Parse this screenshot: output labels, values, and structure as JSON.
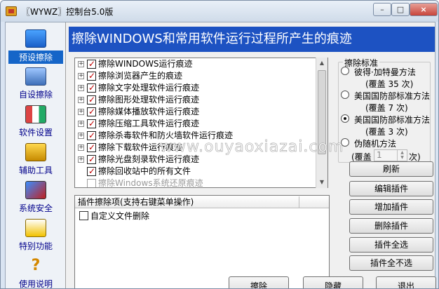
{
  "window": {
    "title": "〖WYWZ〗控制台5.0版",
    "min_label": "–",
    "max_label": "□",
    "close_label": "×"
  },
  "sidebar": {
    "items": [
      {
        "label": "预设擦除",
        "icon": "preset-erase-icon",
        "selected": true
      },
      {
        "label": "自设擦除",
        "icon": "custom-erase-icon",
        "selected": false
      },
      {
        "label": "软件设置",
        "icon": "software-settings-icon",
        "selected": false
      },
      {
        "label": "辅助工具",
        "icon": "helper-tools-icon",
        "selected": false
      },
      {
        "label": "系统安全",
        "icon": "system-security-icon",
        "selected": false
      },
      {
        "label": "特别功能",
        "icon": "special-features-icon",
        "selected": false
      },
      {
        "label": "使用说明",
        "icon": "help-icon",
        "selected": false
      }
    ]
  },
  "banner": "擦除WINDOWS和常用软件运行过程所产生的痕迹",
  "tree": {
    "items": [
      {
        "label": "擦除WINDOWS运行痕迹",
        "checked": true,
        "expandable": true,
        "disabled": false
      },
      {
        "label": "擦除浏览器产生的痕迹",
        "checked": true,
        "expandable": true,
        "disabled": false
      },
      {
        "label": "擦除文字处理软件运行痕迹",
        "checked": true,
        "expandable": true,
        "disabled": false
      },
      {
        "label": "擦除图形处理软件运行痕迹",
        "checked": true,
        "expandable": true,
        "disabled": false
      },
      {
        "label": "擦除媒体播放软件运行痕迹",
        "checked": true,
        "expandable": true,
        "disabled": false
      },
      {
        "label": "擦除压缩工具软件运行痕迹",
        "checked": true,
        "expandable": true,
        "disabled": false
      },
      {
        "label": "擦除杀毒软件和防火墙软件运行痕迹",
        "checked": true,
        "expandable": true,
        "disabled": false
      },
      {
        "label": "擦除下载软件运行痕迹",
        "checked": true,
        "expandable": true,
        "disabled": false
      },
      {
        "label": "擦除光盘刻录软件运行痕迹",
        "checked": true,
        "expandable": true,
        "disabled": false
      },
      {
        "label": "擦除回收站中的所有文件",
        "checked": true,
        "expandable": false,
        "disabled": false
      },
      {
        "label": "擦除Windows系统还原痕迹",
        "checked": false,
        "expandable": false,
        "disabled": true
      }
    ]
  },
  "plugin": {
    "header": "插件擦除项(支持右键菜单操作)",
    "items": [
      {
        "label": "自定义文件删除",
        "checked": false
      }
    ]
  },
  "erase_standard": {
    "legend": "擦除标准",
    "options": [
      {
        "label": "彼得·加特曼方法",
        "sub": "(覆盖 35 次)",
        "selected": false
      },
      {
        "label": "美国国防部标准方法",
        "sub": "(覆盖 7 次)",
        "selected": false
      },
      {
        "label": "美国国防部标准方法",
        "sub": "(覆盖 3 次)",
        "selected": true
      },
      {
        "label": "伪随机方法",
        "sub": "",
        "selected": false
      }
    ],
    "spin_label": "(覆盖",
    "spin_value": "1",
    "spin_unit": "次)"
  },
  "buttons": {
    "refresh": "刷新",
    "edit_plugin": "编辑插件",
    "add_plugin": "增加插件",
    "delete_plugin": "删除插件",
    "select_all_plugins": "插件全选",
    "deselect_all_plugins": "插件全不选",
    "erase": "擦除",
    "hide": "隐藏",
    "exit": "退出"
  },
  "watermark": "www.ouyaoxiazai.com"
}
